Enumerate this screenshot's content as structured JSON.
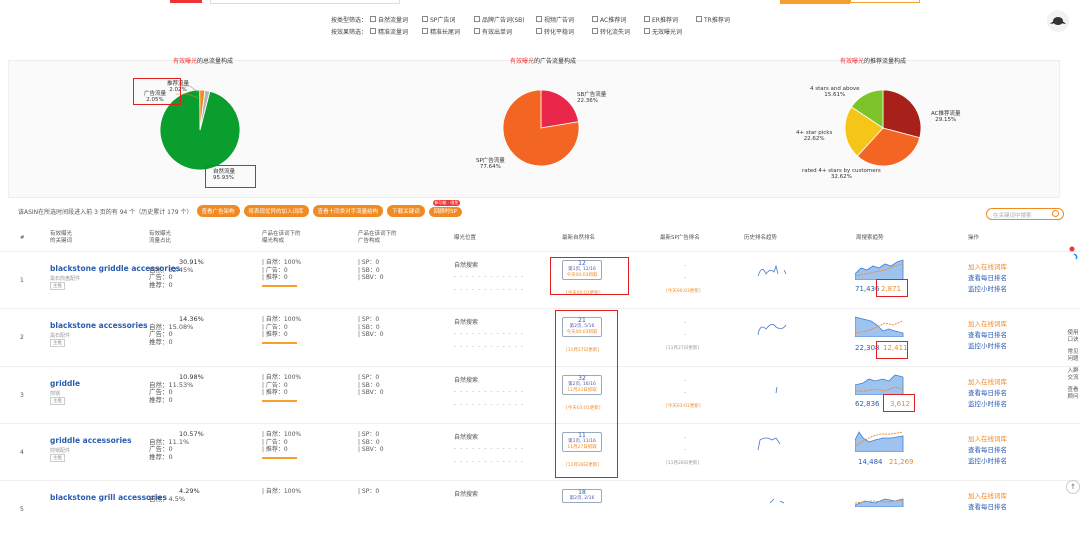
{
  "filters": {
    "row1": {
      "label": "按类型筛选：",
      "items": [
        "自然流量词",
        "SP广告词",
        "品牌广告词(SB)",
        "视频广告词",
        "AC推荐词",
        "ER推荐词",
        "TR推荐词"
      ]
    },
    "row2": {
      "label": "按效果筛选：",
      "items": [
        "精准流量词",
        "精准长尾词",
        "有效出单词",
        "转化平稳词",
        "转化流失词",
        "无效曝光词"
      ]
    }
  },
  "charts": {
    "c1": {
      "title_red": "有效曝光",
      "title_rest": "的总流量构成",
      "labels": {
        "ad": "广告流量\n2.05%",
        "rec": "推荐流量\n2.02%",
        "natural": "自然流量\n95.93%"
      }
    },
    "c2": {
      "title_red": "有效曝光",
      "title_rest": "的广告流量构成",
      "labels": {
        "sb": "SB广告流量\n22.36%",
        "sp": "SP广告流量\n77.64%"
      }
    },
    "c3": {
      "title_red": "有效曝光",
      "title_rest": "的推荐流量构成",
      "labels": {
        "four_above": "4 stars and above\n15.61%",
        "ac": "AC推荐流量\n29.15%",
        "picks": "4+ star picks\n22.62%",
        "rated": "rated 4+ stars by customers\n32.62%"
      }
    }
  },
  "chart_data": [
    {
      "type": "pie",
      "title": "有效曝光的总流量构成",
      "categories": [
        "自然流量",
        "广告流量",
        "推荐流量"
      ],
      "values": [
        95.93,
        2.05,
        2.02
      ],
      "colors": [
        "#0a9e2e",
        "#f08a24",
        "#b8b8b8"
      ]
    },
    {
      "type": "pie",
      "title": "有效曝光的广告流量构成",
      "categories": [
        "SP广告流量",
        "SB广告流量"
      ],
      "values": [
        77.64,
        22.36
      ],
      "colors": [
        "#f26522",
        "#e8274b"
      ]
    },
    {
      "type": "pie",
      "title": "有效曝光的推荐流量构成",
      "categories": [
        "AC推荐流量",
        "rated 4+ stars by customers",
        "4+ star picks",
        "4 stars and above"
      ],
      "values": [
        29.15,
        32.62,
        22.62,
        15.61
      ],
      "colors": [
        "#a8201a",
        "#f26522",
        "#f5c518",
        "#7cc42a"
      ]
    }
  ],
  "toolbar": {
    "summary": "该ASIN在所选时间段进入前 3 页的有 94 个（历史累计 179 个）",
    "pills": [
      "查看广告架构",
      "将表现优异的加入词库",
      "查看十同类对手流量结构",
      "下载关键词",
      "回顾时SP"
    ],
    "tag": "新功能 · 限免",
    "search_placeholder": "在关键词中搜索"
  },
  "headers": {
    "num": "#",
    "kw": "有效曝光\n的关键词",
    "share": "有效曝光\n流量占比",
    "prod_flow": "产品在该词下的\n曝光构成",
    "prod_ad": "产品在该词下的\n广告构成",
    "pos": "曝光位置",
    "rank": "最新自然排名",
    "sprank": "最新SP广告排名",
    "trend": "历史排名趋势",
    "week": "周搜索趋势",
    "ops": "操作"
  },
  "rows": [
    {
      "num": "1",
      "kw": "blackstone griddle accessories",
      "sub": "黑石煎盘配件",
      "badge": "主推",
      "share": "30.91%",
      "nat": "自然：32.45%",
      "ad": "广告：0",
      "rec": "推荐：0",
      "c3a": "| 自然：100%",
      "c3b": "| 广告：0",
      "c3c": "| 推荐：0",
      "c4a": "| SP：0",
      "c4b": "| SB：0",
      "c4c": "| SBV：0",
      "pos": "自然搜索",
      "rank": "12",
      "rank_page": "第1页, 12/16",
      "rank_time": "今天00:03抓取",
      "rank_upd": "[今天00:03更新]",
      "sp": "-",
      "sp_upd": "[今天00:03更新]",
      "v1": "71,436",
      "v2": "2,871",
      "op1": "加入在线词库",
      "op2": "查看每日排名",
      "op3": "监控小时排名"
    },
    {
      "num": "2",
      "kw": "blackstone accessories",
      "sub": "黑石配件",
      "badge": "主推",
      "share": "14.36%",
      "nat": "自然：15.08%",
      "ad": "广告：0",
      "rec": "推荐：0",
      "c3a": "| 自然：100%",
      "c3b": "| 广告：0",
      "c3c": "| 推荐：0",
      "c4a": "| SP：0",
      "c4b": "| SB：0",
      "c4c": "| SBV：0",
      "pos": "自然搜索",
      "rank": "21",
      "rank_page": "第2页, 5/16",
      "rank_time": "今天00:03抓取",
      "rank_upd": "[11月27日更新]",
      "sp": "-",
      "sp_upd": "[11月27日更新]",
      "v1": "22,308",
      "v2": "12,411",
      "op1": "加入在线词库",
      "op2": "查看每日排名",
      "op3": "监控小时排名"
    },
    {
      "num": "3",
      "kw": "griddle",
      "sub": "煎锅",
      "badge": "主推",
      "share": "10.98%",
      "nat": "自然：11.53%",
      "ad": "广告：0",
      "rec": "推荐：0",
      "c3a": "| 自然：100%",
      "c3b": "| 广告：0",
      "c3c": "| 推荐：0",
      "c4a": "| SP：0",
      "c4b": "| SB：0",
      "c4c": "| SBV：0",
      "pos": "自然搜索",
      "rank": "32",
      "rank_page": "第2页, 16/16",
      "rank_time": "11月23日抓取",
      "rank_upd": "[今天03:01更新]",
      "sp": "-",
      "sp_upd": "[今天03:01更新]",
      "v1": "62,836",
      "v2": "3,612",
      "op1": "加入在线词库",
      "op2": "查看每日排名",
      "op3": "监控小时排名"
    },
    {
      "num": "4",
      "kw": "griddle accessories",
      "sub": "煎锅配件",
      "badge": "主推",
      "share": "10.57%",
      "nat": "自然：11.1%",
      "ad": "广告：0",
      "rec": "推荐：0",
      "c3a": "| 自然：100%",
      "c3b": "| 广告：0",
      "c3c": "| 推荐：0",
      "c4a": "| SP：0",
      "c4b": "| SB：0",
      "c4c": "| SBV：0",
      "pos": "自然搜索",
      "rank": "11",
      "rank_page": "第1页, 11/16",
      "rank_time": "11月27日抓取",
      "rank_upd": "[11月28日更新]",
      "sp": "-",
      "sp_upd": "[11月28日更新]",
      "v1": "14,484",
      "v2": "21,269",
      "op1": "加入在线词库",
      "op2": "查看每日排名",
      "op3": "监控小时排名"
    },
    {
      "num": "5",
      "kw": "blackstone grill accessories",
      "share": "4.29%",
      "nat": "自然：4.5%",
      "c3a": "| 自然：100%",
      "c4a": "| SP：0",
      "pos": "自然搜索",
      "rank": "18",
      "rank_page": "第2页, 2/16",
      "op1": "加入在线词库",
      "op2": "查看每日排名"
    }
  ],
  "sidebar": {
    "g1": "使用口诀",
    "g2": "常见问题",
    "g3": "入群交流",
    "g4": "查看顾问",
    "up": "↑"
  }
}
